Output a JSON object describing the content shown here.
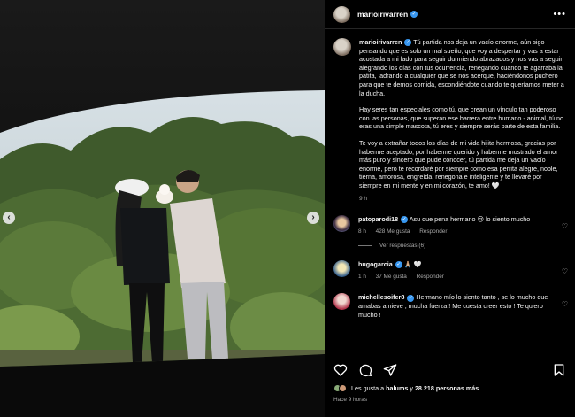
{
  "post": {
    "username": "marioirivarren",
    "verified_mark": "✓",
    "more_icon": "more-horizontal-icon",
    "caption": {
      "username": "marioirivarren",
      "p1": "Tú partida nos deja un vacío enorme, aún sigo pensando que es solo un mal sueño, que voy a despertar y vas a estar acostada a mi lado para seguir durmiendo abrazados y nos vas a seguir alegrando los días con tus ocurrencia, renegando cuando te agarraba la patita, ladrando a cualquier que se nos acerque, haciéndonos puchero para que te demos comida, escondiéndote cuando te queríamos meter a la ducha.",
      "p2": "Hay seres tan especiales como tú, que crean un vínculo tan poderoso con las personas, que superan ese barrera entre humano - animal, tú no eras una simple mascota, tú eres y siempre serás parte de esta familia.",
      "p3": "Te voy a extrañar todos los días de mi vida hijita hermosa, gracias por haberme aceptado, por haberme querido y haberme mostrado el amor más puro y sincero que pude conocer, tú partida me deja un vacío enorme, pero te recordaré por siempre como esa perrita alegre, noble, tierna, amorosa, engreída, renegona e inteligente y te llevaré por siempre en mi mente y en mi corazón, te amo! 🤍",
      "time": "9 h"
    }
  },
  "comments": [
    {
      "username": "patoparodi18",
      "text": "Asu que pena hermano 😢 lo siento mucho",
      "time": "8 h",
      "likes": "428 Me gusta",
      "reply": "Responder",
      "view_replies": "Ver respuestas (6)"
    },
    {
      "username": "hugogarcia",
      "text": "🙏🏼 🤍",
      "time": "1 h",
      "likes": "37 Me gusta",
      "reply": "Responder"
    },
    {
      "username": "michellesoifer8",
      "text": "Hermano mío lo siento tanto , se lo mucho que amabas a nieve , mucha fuerza ! Me cuesta creer esto ! Te quiero mucho !"
    }
  ],
  "footer": {
    "likes_prefix": "Les gusta a ",
    "likes_user": "balums",
    "likes_mid": " y ",
    "likes_count": "28.218 personas más",
    "posted": "Hace 9 horas"
  },
  "icons": {
    "like": "heart-icon",
    "comment": "comment-icon",
    "share": "share-icon",
    "save": "bookmark-icon",
    "prev": "chevron-left-icon",
    "next": "chevron-right-icon"
  },
  "colors": {
    "background": "#000000",
    "verified": "#3897f0",
    "muted": "#a8a8a8"
  }
}
